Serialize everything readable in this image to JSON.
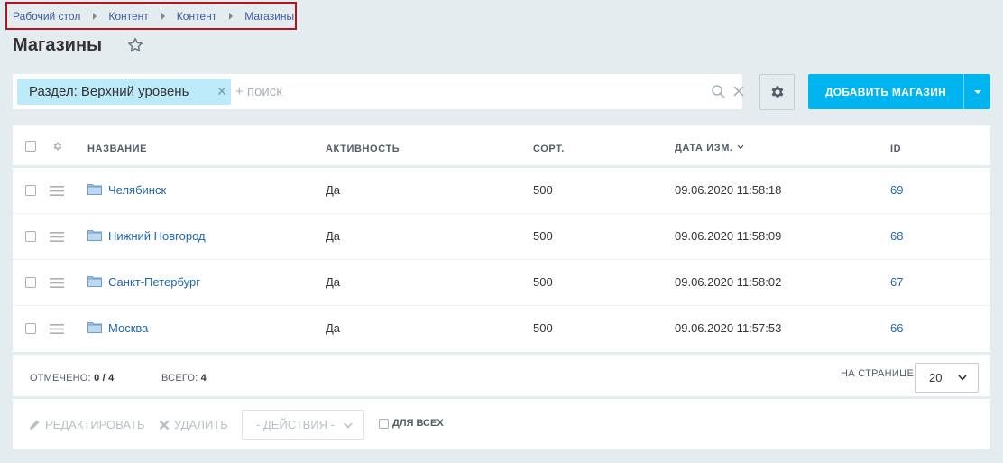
{
  "breadcrumb": [
    {
      "label": "Рабочий стол"
    },
    {
      "label": "Контент"
    },
    {
      "label": "Контент"
    },
    {
      "label": "Магазины"
    }
  ],
  "page": {
    "title": "Магазины"
  },
  "filter": {
    "tag_label": "Раздел: Верхний уровень",
    "search_placeholder": "+ поиск"
  },
  "toolbar": {
    "add_label": "ДОБАВИТЬ МАГАЗИН"
  },
  "table": {
    "columns": {
      "name": "НАЗВАНИЕ",
      "active": "АКТИВНОСТЬ",
      "sort": "СОРТ.",
      "date": "ДАТА ИЗМ.",
      "id": "ID"
    },
    "rows": [
      {
        "name": "Челябинск",
        "active": "Да",
        "sort": "500",
        "date": "09.06.2020 11:58:18",
        "id": "69"
      },
      {
        "name": "Нижний Новгород",
        "active": "Да",
        "sort": "500",
        "date": "09.06.2020 11:58:09",
        "id": "68"
      },
      {
        "name": "Санкт-Петербург",
        "active": "Да",
        "sort": "500",
        "date": "09.06.2020 11:58:02",
        "id": "67"
      },
      {
        "name": "Москва",
        "active": "Да",
        "sort": "500",
        "date": "09.06.2020 11:57:53",
        "id": "66"
      }
    ]
  },
  "footer": {
    "selected_label": "ОТМЕЧЕНО:",
    "selected_value": "0 / 4",
    "total_label": "ВСЕГО:",
    "total_value": "4",
    "per_page_label": "НА СТРАНИЦЕ:",
    "per_page_value": "20"
  },
  "actions": {
    "edit_label": "РЕДАКТИРОВАТЬ",
    "delete_label": "УДАЛИТЬ",
    "select_label": "- ДЕЙСТВИЯ -",
    "for_all_label": "ДЛЯ ВСЕХ"
  },
  "colors": {
    "accent": "#00b4f0",
    "link": "#2067b0",
    "breadcrumb_highlight": "#b5141c",
    "background": "#e5ecef"
  }
}
